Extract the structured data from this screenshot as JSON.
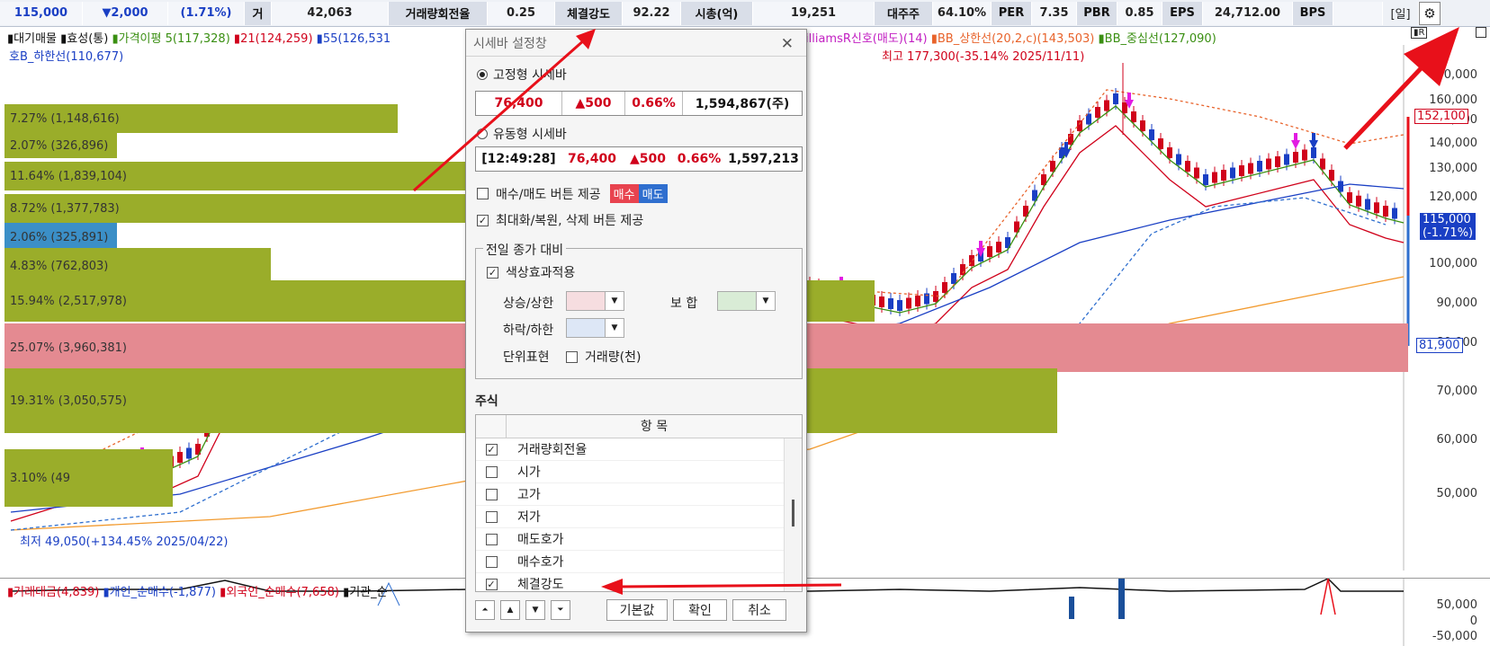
{
  "topbar": {
    "price": "115,000",
    "change": "▼2,000",
    "change_pct": "(1.71%)",
    "cells": [
      {
        "label": "거",
        "value": "42,063"
      },
      {
        "label": "거래량회전율",
        "value": "0.25"
      },
      {
        "label": "체결강도",
        "value": "92.22"
      },
      {
        "label": "시총(억)",
        "value": "19,251"
      },
      {
        "label": "대주주",
        "value": "64.10%"
      },
      {
        "label": "PER",
        "value": "7.35"
      },
      {
        "label": "PBR",
        "value": "0.85"
      },
      {
        "label": "EPS",
        "value": "24,712.00"
      },
      {
        "label": "BPS",
        "value": ""
      }
    ],
    "period": "[일]"
  },
  "legend": {
    "row1": [
      {
        "text": "대기매물",
        "color": "#111"
      },
      {
        "text": "효성(통)",
        "color": "#111"
      },
      {
        "text": "가격이평 5(117,328)",
        "color": "#3a8f12"
      },
      {
        "text": "21(124,259)",
        "color": "#d0021b"
      },
      {
        "text": "55(126,531",
        "color": "#1a3fc4"
      }
    ],
    "row1_right": [
      {
        "text": "illiamsR신호(매도)(14)",
        "color": "#c21fc2"
      },
      {
        "text": "BB_상한선(20,2,c)(143,503)",
        "color": "#e8632b"
      },
      {
        "text": "BB_중심선(127,090)",
        "color": "#3a8f12"
      }
    ],
    "row2": "호B_하한선(110,677)",
    "high_note": "최고 177,300(-35.14% 2025/11/11)",
    "low_note": "최저 49,050(+134.45% 2025/04/22)"
  },
  "volume_bars": [
    {
      "text": "7.27% (1,148,616)",
      "color": "#9aad2a",
      "frac": 0.28,
      "row": 0
    },
    {
      "text": "2.07% (326,896)",
      "color": "#9aad2a",
      "frac": 0.08,
      "row": 1
    },
    {
      "text": "11.64% (1,839,104)",
      "color": "#9aad2a",
      "frac": 0.44,
      "row": 2
    },
    {
      "text": "8.72% (1,377,783)",
      "color": "#9aad2a",
      "frac": 0.34,
      "row": 3
    },
    {
      "text": "2.06% (325,891)",
      "color": "#3b8fc7",
      "frac": 0.08,
      "row": 4
    },
    {
      "text": "4.83% (762,803)",
      "color": "#9aad2a",
      "frac": 0.19,
      "row": 5
    },
    {
      "text": "15.94% (2,517,978)",
      "color": "#9aad2a",
      "frac": 0.62,
      "row": 6
    },
    {
      "text": "25.07% (3,960,381)",
      "color": "#e48a91",
      "frac": 1.0,
      "row": 7
    },
    {
      "text": "19.31% (3,050,575)",
      "color": "#9aad2a",
      "frac": 0.75,
      "row": 8
    },
    {
      "text": "3.10% (49",
      "color": "#9aad2a",
      "frac": 0.12,
      "row": 9
    }
  ],
  "y_axis": [
    "170,000",
    "160,000",
    "150,000",
    "140,000",
    "130,000",
    "120,000",
    "100,000",
    "90,000",
    "80,000",
    "70,000",
    "60,000",
    "50,000"
  ],
  "price_tags": {
    "top": "152,100",
    "current": "115,000",
    "current_pct": "(-1.71%)",
    "bottom": "81,900"
  },
  "subpane": {
    "legend": [
      {
        "text": "거래대금(4,839)",
        "color": "#d0021b"
      },
      {
        "text": "개인_순매수(-1,877)",
        "color": "#1a3fc4"
      },
      {
        "text": "외국인_순매수(7,658)",
        "color": "#d0021b"
      },
      {
        "text": "기관_순",
        "color": "#111"
      }
    ],
    "axis": [
      "50,000",
      "0",
      "-50,000"
    ]
  },
  "dialog": {
    "title": "시세바 설정창",
    "fixed_label": "고정형 시세바",
    "fixed_box": [
      "76,400",
      "▲500",
      "0.66%",
      "1,594,867(주)"
    ],
    "float_label": "유동형 시세바",
    "float_box": [
      "[12:49:28]",
      "76,400",
      "▲500",
      "0.66%",
      "1,597,213"
    ],
    "opt_buysell": "매수/매도 버튼 제공",
    "buy": "매수",
    "sell": "매도",
    "opt_maxrestore": "최대화/복원, 삭제 버튼 제공",
    "group_title": "전일 종가 대비",
    "color_effect": "색상효과적용",
    "up_label": "상승/상한",
    "flat_label": "보 합",
    "down_label": "하락/하한",
    "unit_label": "단위표현",
    "volume_unit": "거래량(천)",
    "stock_title": "주식",
    "table_header": "항 목",
    "items": [
      {
        "label": "거래량회전율",
        "checked": true
      },
      {
        "label": "시가",
        "checked": false
      },
      {
        "label": "고가",
        "checked": false
      },
      {
        "label": "저가",
        "checked": false
      },
      {
        "label": "매도호가",
        "checked": false
      },
      {
        "label": "매수호가",
        "checked": false
      },
      {
        "label": "체결강도",
        "checked": true
      }
    ],
    "btn_default": "기본값",
    "btn_ok": "확인",
    "btn_cancel": "취소"
  },
  "colors": {
    "up": "#d0021b",
    "down": "#1a3fc4",
    "arrow": "#e8101a"
  }
}
